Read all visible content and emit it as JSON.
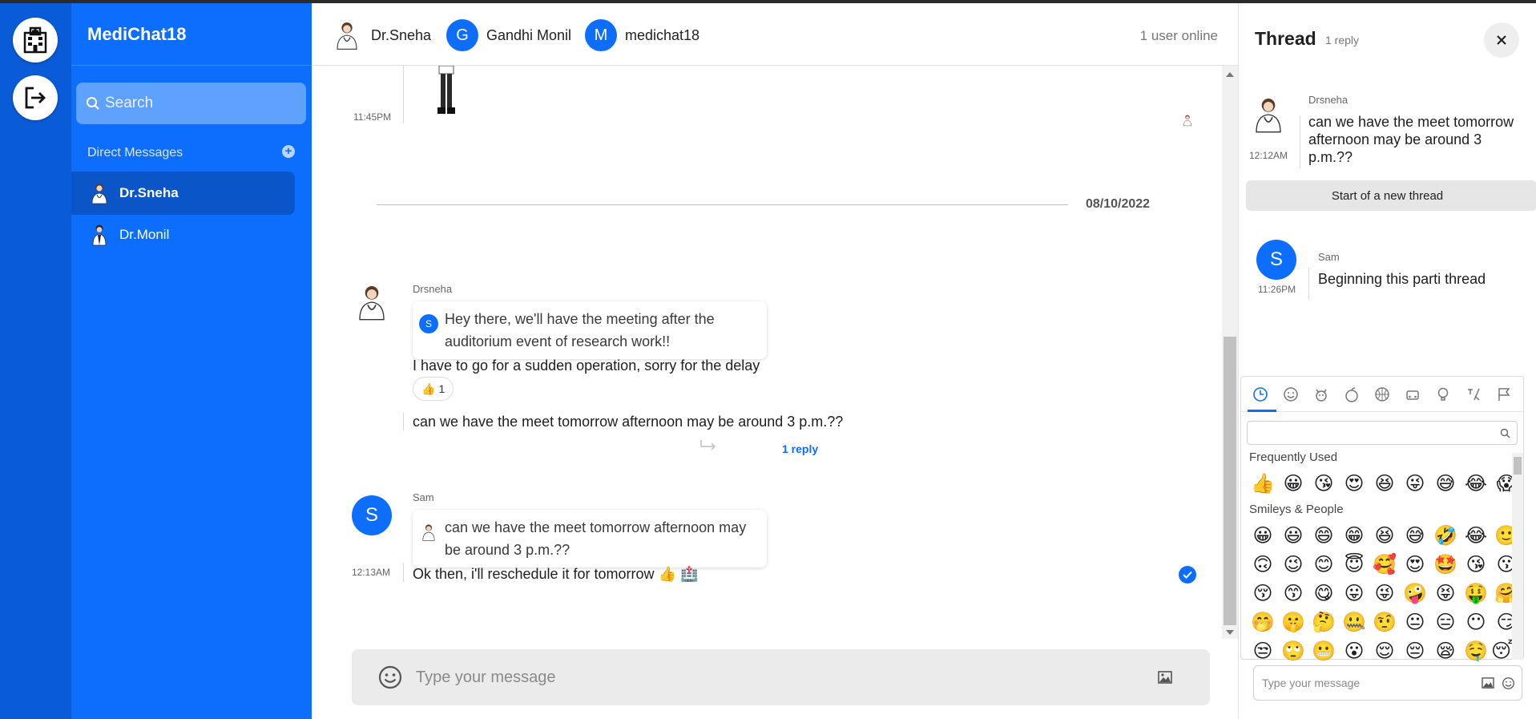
{
  "app": {
    "brand": "MediChat18"
  },
  "colors": {
    "accent": "#0d6efd",
    "rail": "#0a5bd7",
    "composer": "#ebebeb"
  },
  "rail": {
    "icons": [
      "hospital-icon",
      "logout-icon"
    ]
  },
  "sidebar": {
    "search_placeholder": "Search",
    "section_label": "Direct Messages",
    "items": [
      {
        "label": "Dr.Sneha",
        "active": true
      },
      {
        "label": "Dr.Monil",
        "active": false
      }
    ]
  },
  "header": {
    "members": [
      {
        "label": "Dr.Sneha",
        "avatar": "doctor-avatar"
      },
      {
        "label": "Gandhi Monil",
        "initial": "G"
      },
      {
        "label": "medichat18",
        "initial": "M"
      }
    ],
    "online": "1 user online"
  },
  "messages": {
    "first_time": "11:45PM",
    "date_divider": "08/10/2022",
    "group1": {
      "sender": "Drsneha",
      "quote": {
        "initial": "S",
        "text": "Hey there, we'll have the meeting after the auditorium event of research work!!"
      },
      "text1": "I have to go for a sudden operation, sorry for the delay",
      "reaction": {
        "emoji": "👍",
        "count": "1"
      },
      "text2": "can we have the meet tomorrow afternoon may be around 3 p.m.??",
      "reply_link": "1 reply"
    },
    "group2": {
      "sender": "Sam",
      "initial": "S",
      "time": "12:13AM",
      "quote": {
        "text": "can we have the meet tomorrow afternoon may be around 3 p.m.??"
      },
      "text": "Ok then, i'll reschedule it for tomorrow 👍 🏥"
    }
  },
  "composer": {
    "placeholder": "Type your message"
  },
  "thread": {
    "title": "Thread",
    "count": "1 reply",
    "parent": {
      "sender": "Drsneha",
      "time": "12:12AM",
      "text": "can we have the meet tomorrow afternoon may be around 3 p.m.??"
    },
    "start_label": "Start of a new thread",
    "reply": {
      "sender": "Sam",
      "initial": "S",
      "time": "11:26PM",
      "text": "Beginning this parti thread"
    },
    "composer_placeholder": "Type your message"
  },
  "emoji_picker": {
    "categories": [
      "clock-icon",
      "smiley-icon",
      "animal-icon",
      "food-icon",
      "ball-icon",
      "car-icon",
      "bulb-icon",
      "symbols-icon",
      "flag-icon"
    ],
    "frequent_title": "Frequently Used",
    "frequent": [
      "👍",
      "😀",
      "😘",
      "😍",
      "😆",
      "😜",
      "😅",
      "😂",
      "😱"
    ],
    "smileys_title": "Smileys & People",
    "smileys": [
      "😀",
      "😃",
      "😄",
      "😁",
      "😆",
      "😅",
      "🤣",
      "😂",
      "🙂",
      "🙃",
      "😉",
      "😊",
      "😇",
      "🥰",
      "😍",
      "🤩",
      "😘",
      "😗",
      "😚",
      "😙",
      "😋",
      "😛",
      "😜",
      "🤪",
      "😝",
      "🤑",
      "🤗",
      "🤭",
      "🤫",
      "🤔",
      "🤐",
      "🤨",
      "😐",
      "😑",
      "😶",
      "😏",
      "😒",
      "🙄",
      "😬",
      "😮",
      "😌",
      "😔",
      "😪",
      "🤤",
      "😴"
    ]
  }
}
